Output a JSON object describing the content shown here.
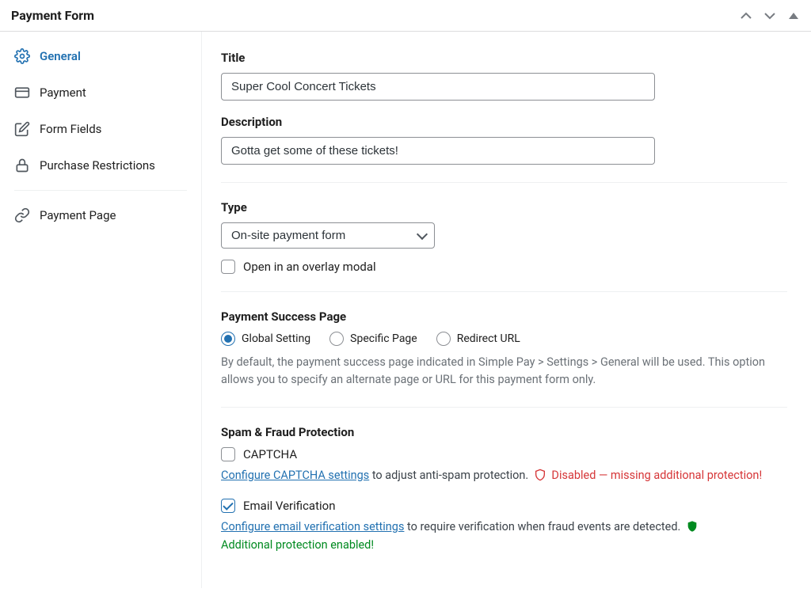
{
  "panel": {
    "title": "Payment Form"
  },
  "sidebar": {
    "items": [
      {
        "label": "General"
      },
      {
        "label": "Payment"
      },
      {
        "label": "Form Fields"
      },
      {
        "label": "Purchase Restrictions"
      },
      {
        "label": "Payment Page"
      }
    ]
  },
  "fields": {
    "title": {
      "label": "Title",
      "value": "Super Cool Concert Tickets"
    },
    "description": {
      "label": "Description",
      "value": "Gotta get some of these tickets!"
    },
    "type": {
      "label": "Type",
      "selected": "On-site payment form"
    },
    "overlay": {
      "label": "Open in an overlay modal"
    }
  },
  "successPage": {
    "label": "Payment Success Page",
    "options": [
      "Global Setting",
      "Specific Page",
      "Redirect URL"
    ],
    "help": "By default, the payment success page indicated in Simple Pay > Settings > General will be used. This option allows you to specify an alternate page or URL for this payment form only."
  },
  "spam": {
    "label": "Spam & Fraud Protection",
    "captcha": {
      "label": "CAPTCHA",
      "link": "Configure CAPTCHA settings",
      "tail": " to adjust anti-spam protection. ",
      "status": " Disabled — missing additional protection!"
    },
    "email": {
      "label": "Email Verification",
      "link": "Configure email verification settings",
      "tail": " to require verification when fraud events are detected. ",
      "status": "Additional protection enabled!"
    }
  }
}
